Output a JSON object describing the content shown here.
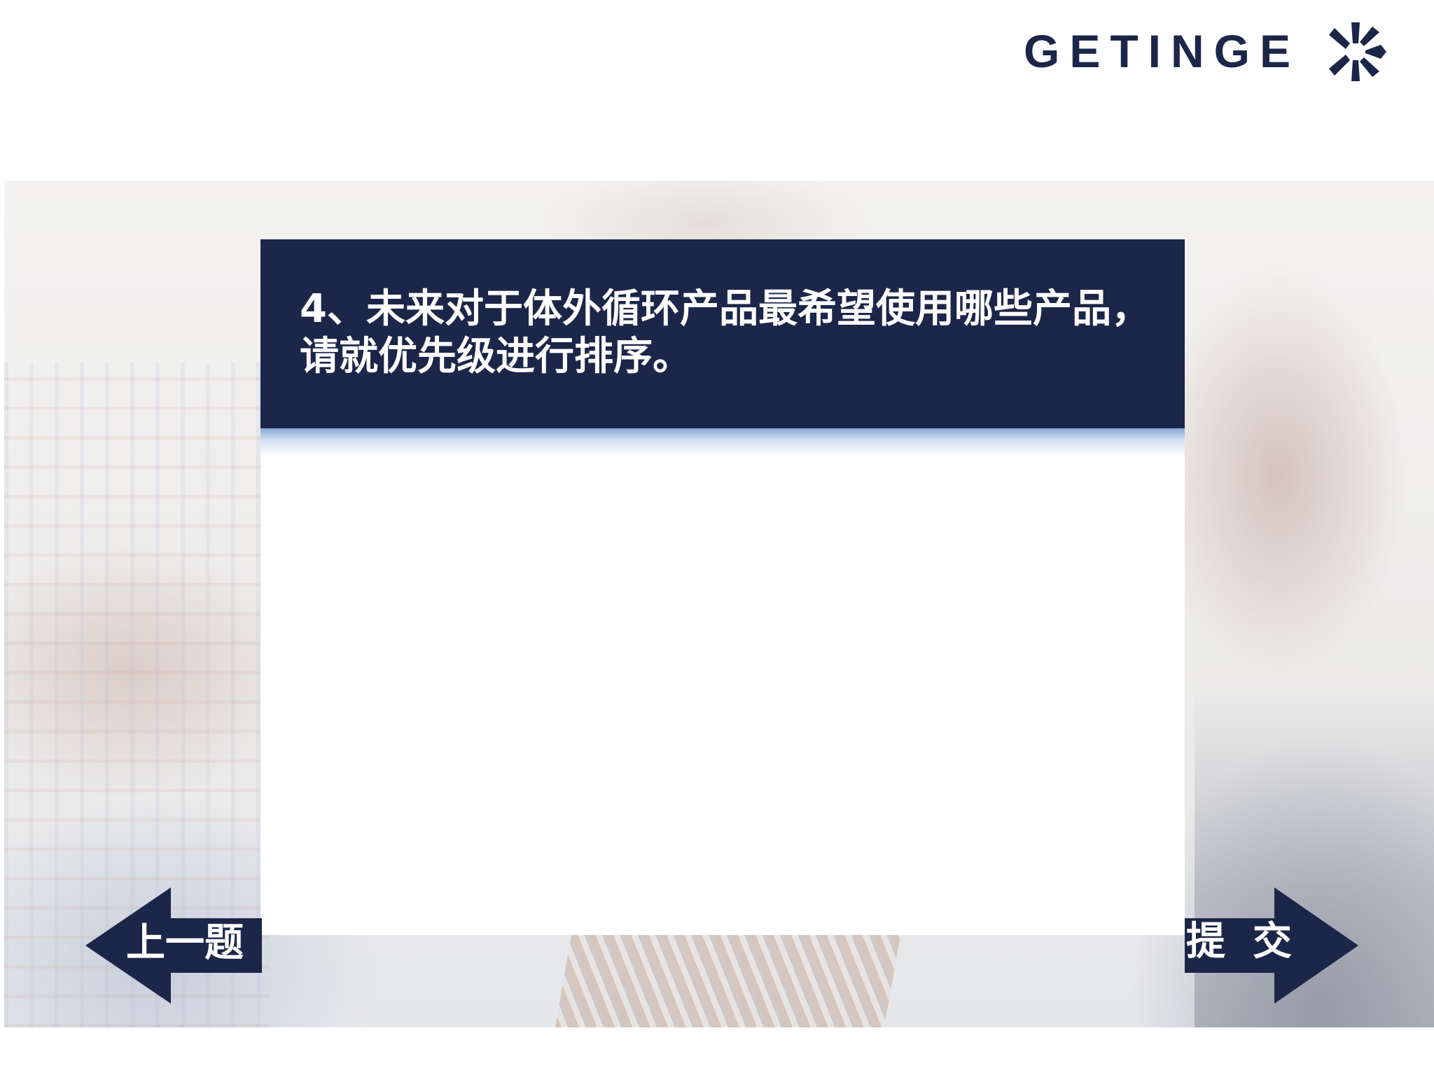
{
  "brand": {
    "name": "GETINGE",
    "logo_icon": "getinge-star-icon",
    "color": "#1b2649"
  },
  "question": {
    "line1": "4、未来对于体外循环产品最希望使用哪些产品，",
    "line2": "请就优先级进行排序。"
  },
  "navigation": {
    "prev_label": "上一题",
    "submit_label": "提  交",
    "prev_icon": "arrow-left-icon",
    "submit_icon": "arrow-right-icon"
  },
  "colors": {
    "header_bg": "#1b2649",
    "text_on_header": "#ffffff",
    "fade_accent": "#8aa8d6"
  }
}
